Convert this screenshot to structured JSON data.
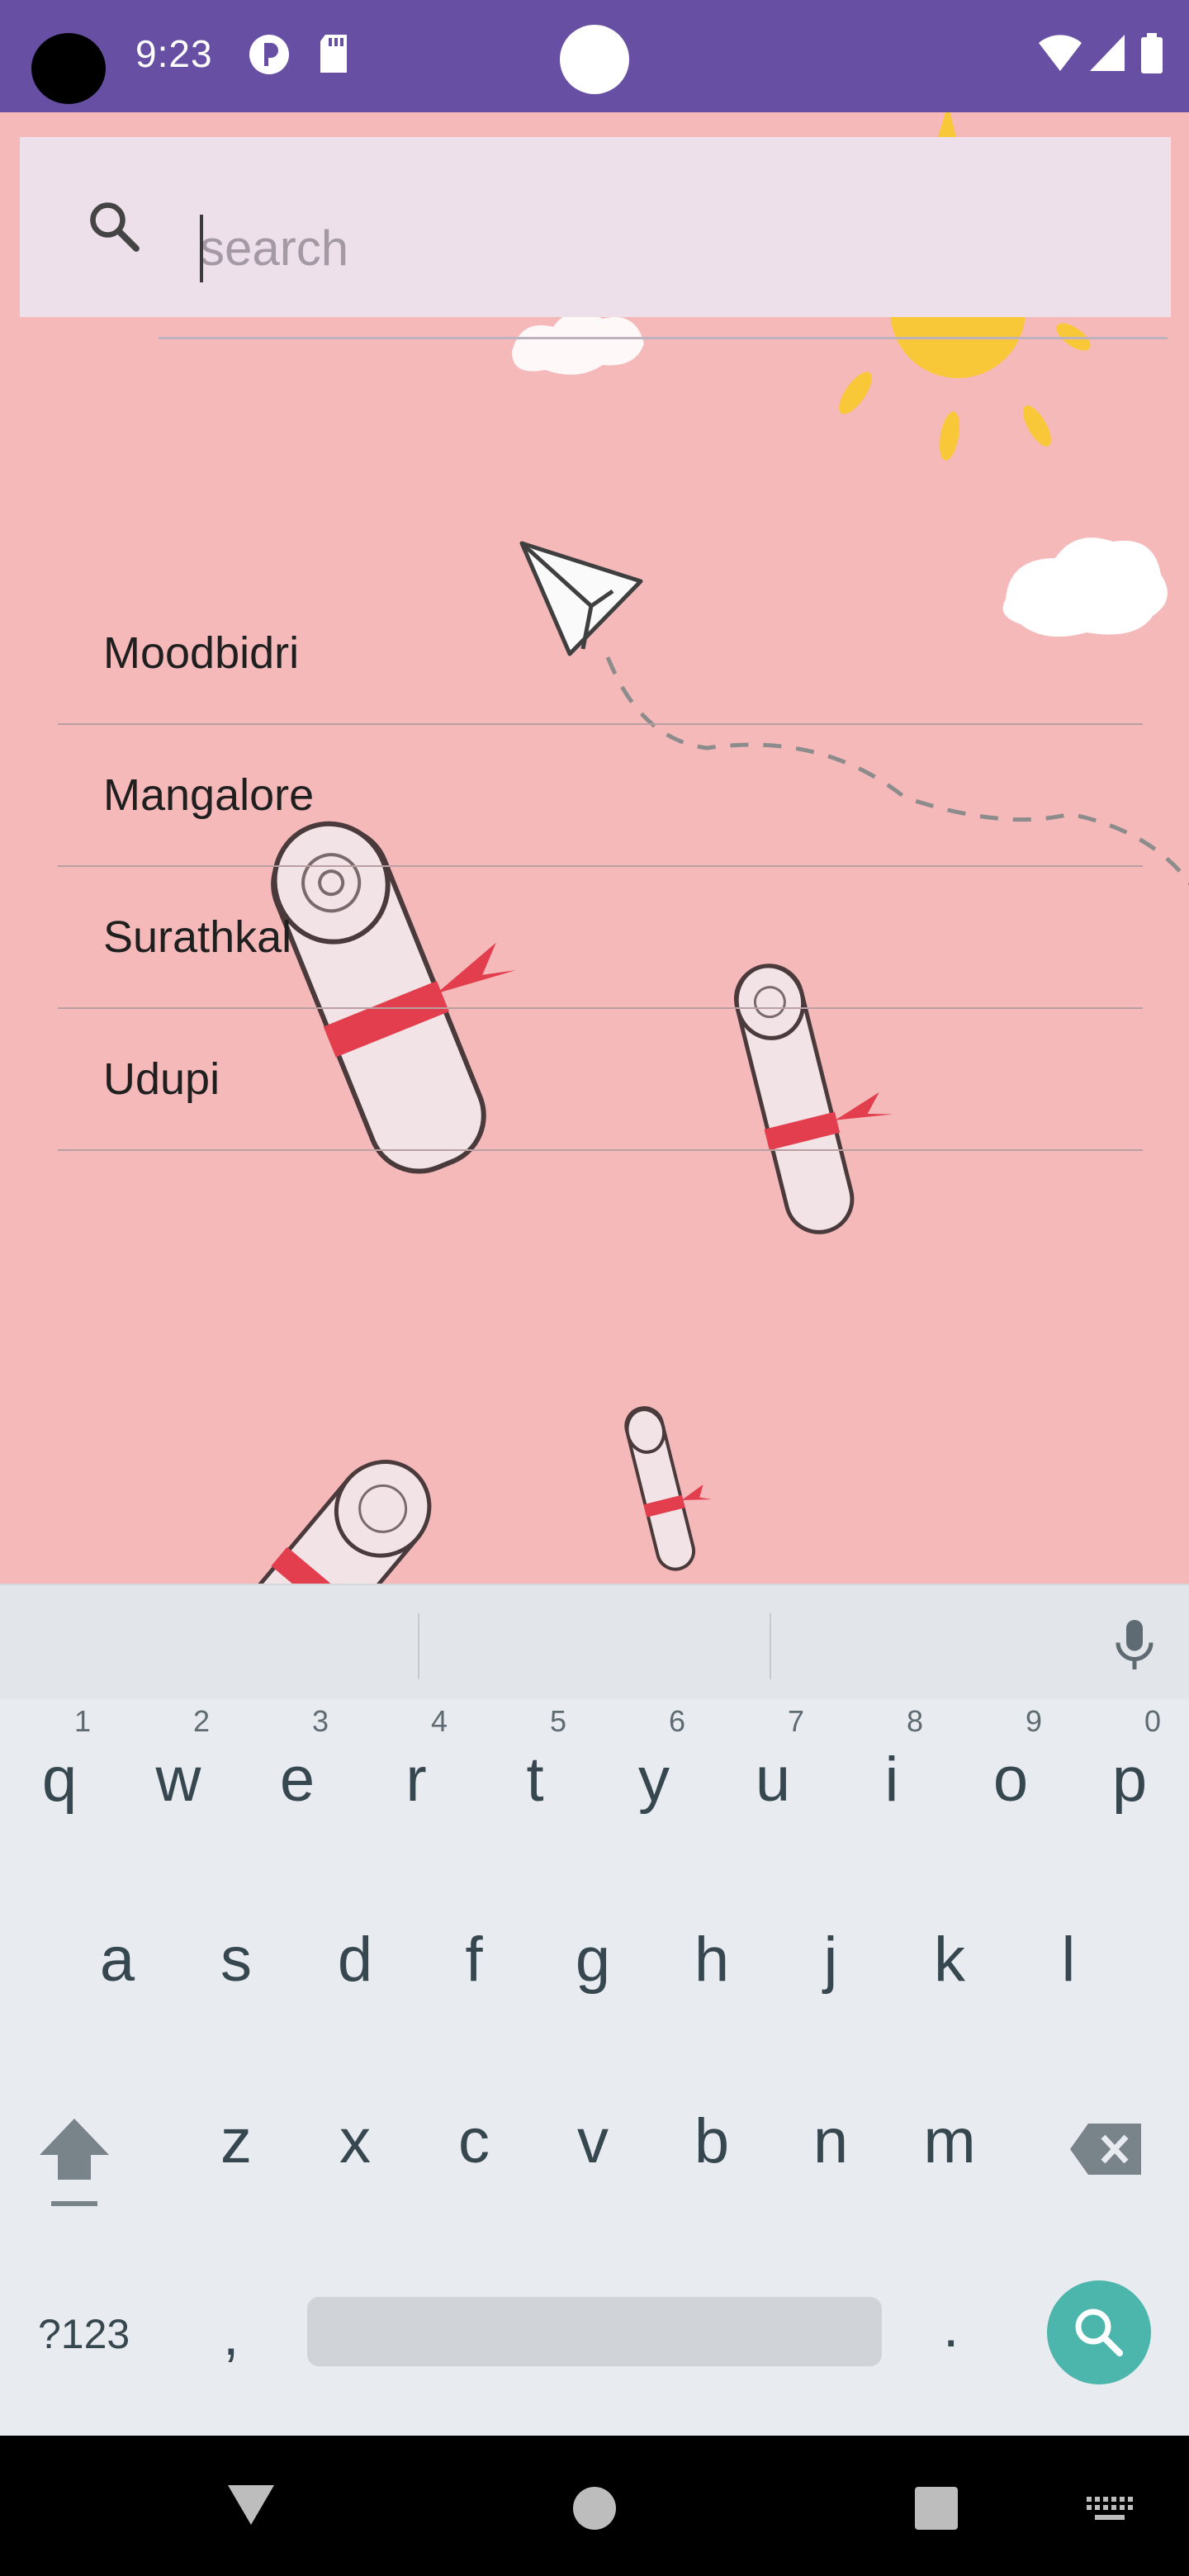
{
  "status_bar": {
    "time": "9:23",
    "background": "#6750a4",
    "icons": [
      "camera-cutout",
      "p-icon",
      "sd-card-icon",
      "wifi-icon",
      "signal-icon",
      "battery-icon"
    ]
  },
  "search": {
    "placeholder": "search",
    "value": "",
    "icon": "search-icon"
  },
  "list": {
    "items": [
      {
        "label": "Moodbidri"
      },
      {
        "label": "Mangalore"
      },
      {
        "label": "Surathkal"
      },
      {
        "label": "Udupi"
      }
    ]
  },
  "keyboard": {
    "row1": [
      {
        "key": "q",
        "hint": "1"
      },
      {
        "key": "w",
        "hint": "2"
      },
      {
        "key": "e",
        "hint": "3"
      },
      {
        "key": "r",
        "hint": "4"
      },
      {
        "key": "t",
        "hint": "5"
      },
      {
        "key": "y",
        "hint": "6"
      },
      {
        "key": "u",
        "hint": "7"
      },
      {
        "key": "i",
        "hint": "8"
      },
      {
        "key": "o",
        "hint": "9"
      },
      {
        "key": "p",
        "hint": "0"
      }
    ],
    "row2": [
      "a",
      "s",
      "d",
      "f",
      "g",
      "h",
      "j",
      "k",
      "l"
    ],
    "row3": [
      "z",
      "x",
      "c",
      "v",
      "b",
      "n",
      "m"
    ],
    "symbols_label": "?123",
    "comma_label": ",",
    "period_label": ".",
    "enter_icon": "search-icon",
    "accent": "#4db6ac"
  },
  "navbar": {
    "icons": [
      "back-icon",
      "home-icon",
      "recents-icon",
      "keyboard-switch-icon"
    ]
  },
  "colors": {
    "app_background": "#f6b9ba",
    "search_background": "#ede0ea",
    "keyboard_background": "#e8ebef"
  }
}
